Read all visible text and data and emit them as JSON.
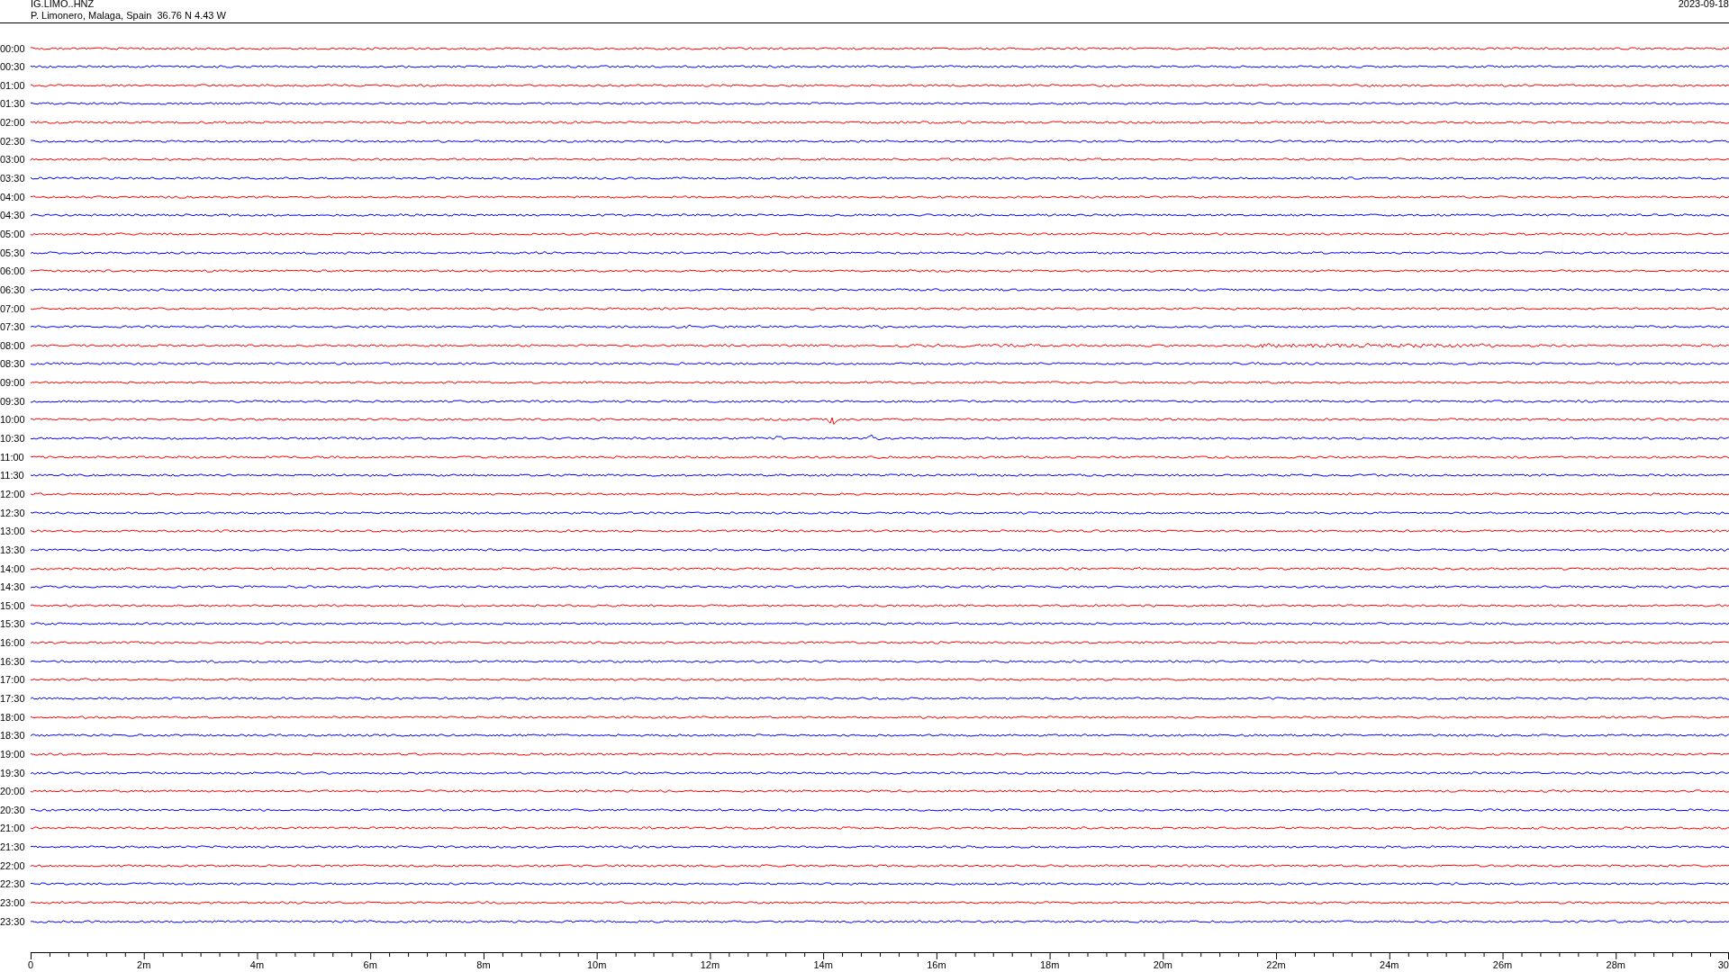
{
  "header": {
    "channel": "IG.LIMO..HNZ",
    "station": "P. Limonero, Malaga, Spain  36.76 N 4.43 W",
    "date": "2023-09-18"
  },
  "traces": [
    {
      "label": "00:00",
      "color": "#ff0000"
    },
    {
      "label": "00:30",
      "color": "#0000ff"
    },
    {
      "label": "01:00",
      "color": "#ff0000"
    },
    {
      "label": "01:30",
      "color": "#0000ff"
    },
    {
      "label": "02:00",
      "color": "#ff0000"
    },
    {
      "label": "02:30",
      "color": "#0000ff"
    },
    {
      "label": "03:00",
      "color": "#ff0000"
    },
    {
      "label": "03:30",
      "color": "#0000ff"
    },
    {
      "label": "04:00",
      "color": "#ff0000"
    },
    {
      "label": "04:30",
      "color": "#0000ff"
    },
    {
      "label": "05:00",
      "color": "#ff0000"
    },
    {
      "label": "05:30",
      "color": "#0000ff"
    },
    {
      "label": "06:00",
      "color": "#ff0000"
    },
    {
      "label": "06:30",
      "color": "#0000ff"
    },
    {
      "label": "07:00",
      "color": "#ff0000"
    },
    {
      "label": "07:30",
      "color": "#0000ff"
    },
    {
      "label": "08:00",
      "color": "#ff0000"
    },
    {
      "label": "08:30",
      "color": "#0000ff"
    },
    {
      "label": "09:00",
      "color": "#ff0000"
    },
    {
      "label": "09:30",
      "color": "#0000ff"
    },
    {
      "label": "10:00",
      "color": "#ff0000"
    },
    {
      "label": "10:30",
      "color": "#0000ff"
    },
    {
      "label": "11:00",
      "color": "#ff0000"
    },
    {
      "label": "11:30",
      "color": "#0000ff"
    },
    {
      "label": "12:00",
      "color": "#ff0000"
    },
    {
      "label": "12:30",
      "color": "#0000ff"
    },
    {
      "label": "13:00",
      "color": "#ff0000"
    },
    {
      "label": "13:30",
      "color": "#0000ff"
    },
    {
      "label": "14:00",
      "color": "#ff0000"
    },
    {
      "label": "14:30",
      "color": "#0000ff"
    },
    {
      "label": "15:00",
      "color": "#ff0000"
    },
    {
      "label": "15:30",
      "color": "#0000ff"
    },
    {
      "label": "16:00",
      "color": "#ff0000"
    },
    {
      "label": "16:30",
      "color": "#0000ff"
    },
    {
      "label": "17:00",
      "color": "#ff0000"
    },
    {
      "label": "17:30",
      "color": "#0000ff"
    },
    {
      "label": "18:00",
      "color": "#ff0000"
    },
    {
      "label": "18:30",
      "color": "#0000ff"
    },
    {
      "label": "19:00",
      "color": "#ff0000"
    },
    {
      "label": "19:30",
      "color": "#0000ff"
    },
    {
      "label": "20:00",
      "color": "#ff0000"
    },
    {
      "label": "20:30",
      "color": "#0000ff"
    },
    {
      "label": "21:00",
      "color": "#ff0000"
    },
    {
      "label": "21:30",
      "color": "#0000ff"
    },
    {
      "label": "22:00",
      "color": "#ff0000"
    },
    {
      "label": "22:30",
      "color": "#0000ff"
    },
    {
      "label": "23:00",
      "color": "#ff0000"
    },
    {
      "label": "23:30",
      "color": "#0000ff"
    }
  ],
  "time_axis": {
    "ticks": [
      "0",
      "2m",
      "4m",
      "6m",
      "8m",
      "10m",
      "12m",
      "14m",
      "16m",
      "18m",
      "20m",
      "22m",
      "24m",
      "26m",
      "28m",
      "30"
    ]
  }
}
